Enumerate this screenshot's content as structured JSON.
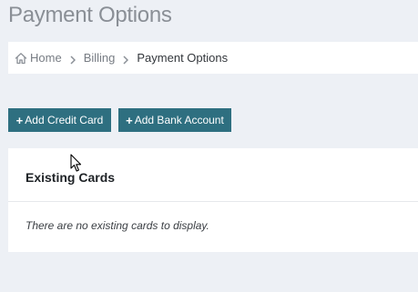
{
  "page": {
    "title": "Payment Options"
  },
  "breadcrumb": {
    "items": [
      {
        "label": "Home",
        "icon": "home-icon"
      },
      {
        "label": "Billing"
      },
      {
        "label": "Payment Options"
      }
    ]
  },
  "actions": {
    "add_credit_card": "Add Credit Card",
    "add_bank_account": "Add Bank Account",
    "plus_glyph": "+"
  },
  "existing_cards": {
    "heading": "Existing Cards",
    "empty_message": "There are no existing cards to display."
  },
  "colors": {
    "background": "#edf0f5",
    "button": "#2e6f80",
    "panel": "#ffffff"
  }
}
